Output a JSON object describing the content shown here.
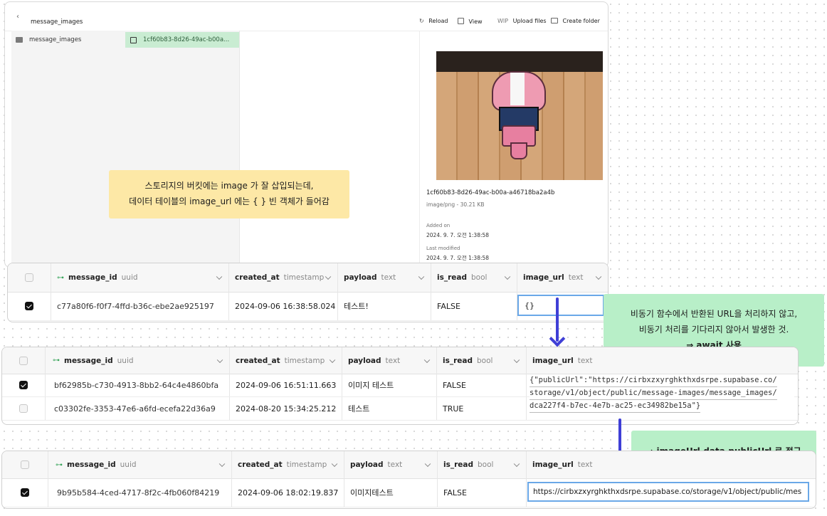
{
  "storage": {
    "breadcrumb": "message_images",
    "toolbar": {
      "reload": "Reload",
      "view": "View",
      "wip": "WIP",
      "upload": "Upload files",
      "create_folder": "Create folder"
    },
    "folder": "message_images",
    "selected_file": "1cf60b83-8d26-49ac-b00a...",
    "preview": {
      "filename": "1cf60b83-8d26-49ac-b00a-a46718ba2a4b",
      "meta": "image/png - 30.21 KB",
      "added_label": "Added on",
      "added_value": "2024. 9. 7. 오전 1:38:58",
      "modified_label": "Last modified",
      "modified_value": "2024. 9. 7. 오전 1:38:58"
    }
  },
  "notes": {
    "yellow_line1": "스토리지의 버킷에는 image 가 잘 삽입되는데,",
    "yellow_line2": "데이터 테이블의 image_url 에는 { } 빈 객체가 들어감",
    "green1_line1": "비동기 함수에서 반환된 URL을 처리하지 않고,",
    "green1_line2": "비동기 처리를 기다리지 않아서 발생한 것.",
    "green1_line3": "⇒ await 사용",
    "green2": "⇒ imageUrl.data.publicUrl 로 접근"
  },
  "columns": {
    "message_id": "message_id",
    "message_id_t": "uuid",
    "created_at": "created_at",
    "created_at_t": "timestamp",
    "payload": "payload",
    "payload_t": "text",
    "is_read": "is_read",
    "is_read_t": "bool",
    "image_url": "image_url",
    "image_url_t": "text"
  },
  "table1": {
    "rows": [
      {
        "message_id": "c77a80f6-f0f7-4ffd-b36c-ebe2ae925197",
        "created_at": "2024-09-06 16:38:58.024",
        "payload": "테스트!",
        "is_read": "FALSE",
        "image_url": "{}"
      }
    ]
  },
  "table2": {
    "rows": [
      {
        "message_id": "bf62985b-c730-4913-8bb2-64c4e4860bfa",
        "created_at": "2024-09-06 16:51:11.663",
        "payload": "이미지 테스트",
        "is_read": "FALSE"
      },
      {
        "message_id": "c03302fe-3353-47e6-a6fd-ecefa22d36a9",
        "created_at": "2024-08-20 15:34:25.212",
        "payload": "테스트",
        "is_read": "TRUE"
      }
    ],
    "json_line1": "{\"publicUrl\":\"https://cirbxzxyrghkthxdsrpe.supabase.co/",
    "json_line2": "storage/v1/object/public/message-images/message_images/",
    "json_line3": "dca227f4-b7ec-4e7b-ac25-ec34982be15a\"}"
  },
  "table3": {
    "rows": [
      {
        "message_id": "9b95b584-4ced-4717-8f2c-4fb060f84219",
        "created_at": "2024-09-06 18:02:19.837",
        "payload": "이미지테스트",
        "is_read": "FALSE",
        "image_url": "https://cirbxzxyrghkthxdsrpe.supabase.co/storage/v1/object/public/mes"
      }
    ]
  }
}
